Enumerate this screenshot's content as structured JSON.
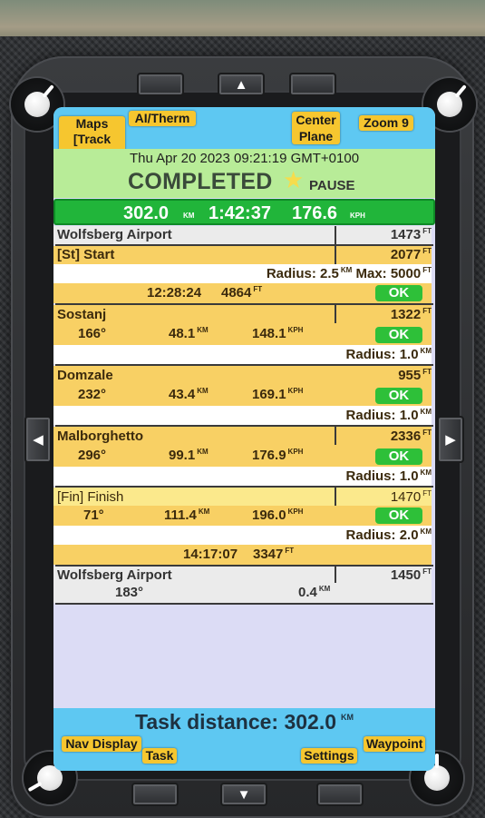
{
  "hardware": {
    "up_glyph": "▲",
    "down_glyph": "▼",
    "left_glyph": "◀",
    "right_glyph": "▶"
  },
  "softkeys": {
    "maps": "Maps",
    "track_up": "[Track Up]",
    "ai_therm": "AI/Therm",
    "center": "Center",
    "plane": "Plane",
    "zoom": "Zoom 9",
    "nav_display": "Nav Display",
    "task": "Task",
    "settings": "Settings",
    "waypoint": "Waypoint"
  },
  "status": {
    "date": "Thu Apr 20 2023 09:21:19 GMT+0100",
    "completed": "COMPLETED",
    "pause": "PAUSE",
    "distance": "302.0",
    "distance_unit": "KM",
    "time": "1:42:37",
    "speed": "176.6",
    "speed_unit": "KPH"
  },
  "waypoints": {
    "origin": {
      "name": "Wolfsberg Airport",
      "elev": "1473",
      "unit": "FT"
    },
    "start": {
      "name": "[St] Start",
      "elev": "2077",
      "unit": "FT",
      "radius_label": "Radius: 2.5",
      "radius_unit": "KM",
      "max_label": "Max: 5000",
      "max_unit": "FT",
      "time": "12:28:24",
      "alt": "4864",
      "alt_unit": "FT",
      "ok": "OK"
    },
    "legs": [
      {
        "name": "Sostanj",
        "elev": "1322",
        "bearing": "166°",
        "dist": "48.1",
        "speed": "148.1",
        "radius": "Radius: 1.0",
        "ok": "OK"
      },
      {
        "name": "Domzale",
        "elev": "955",
        "bearing": "232°",
        "dist": "43.4",
        "speed": "169.1",
        "radius": "Radius: 1.0",
        "ok": "OK"
      },
      {
        "name": "Malborghetto",
        "elev": "2336",
        "bearing": "296°",
        "dist": "99.1",
        "speed": "176.9",
        "radius": "Radius: 1.0",
        "ok": "OK"
      }
    ],
    "finish": {
      "name": "[Fin] Finish",
      "elev": "1470",
      "bearing": "71°",
      "dist": "111.4",
      "speed": "196.0",
      "radius": "Radius: 2.0",
      "ok": "OK",
      "time": "14:17:07",
      "alt": "3347"
    },
    "destination": {
      "name": "Wolfsberg Airport",
      "elev": "1450",
      "bearing": "183°",
      "dist": "0.4"
    },
    "units": {
      "ft": "FT",
      "km": "KM",
      "kph": "KPH"
    }
  },
  "task_distance": {
    "label": "Task distance: 302.0",
    "unit": "KM"
  }
}
